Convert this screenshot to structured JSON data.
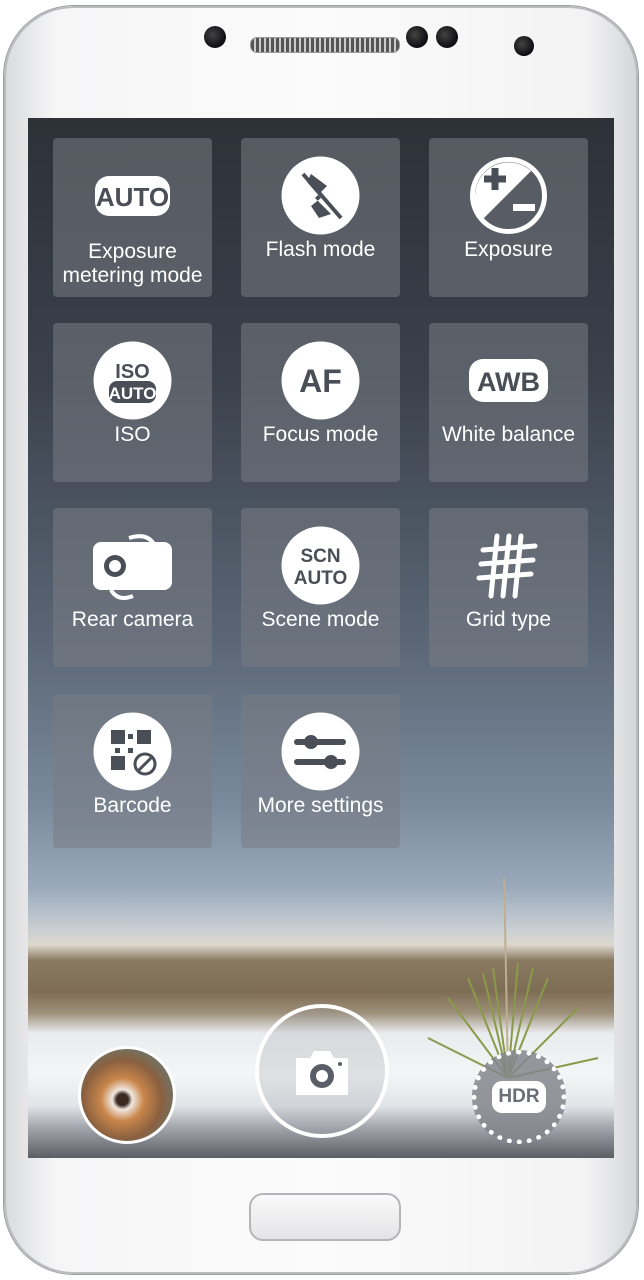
{
  "tiles": [
    {
      "label": "Exposure metering mode",
      "line1": "Exposure",
      "line2": "metering mode",
      "icon": "auto-metering-icon",
      "badge": "AUTO"
    },
    {
      "label": "Flash mode",
      "icon": "flash-off-icon"
    },
    {
      "label": "Exposure",
      "icon": "exposure-plus-minus-icon"
    },
    {
      "label": "ISO",
      "icon": "iso-auto-icon",
      "badge_top": "ISO",
      "badge_bottom": "AUTO"
    },
    {
      "label": "Focus mode",
      "icon": "af-icon",
      "badge": "AF"
    },
    {
      "label": "White balance",
      "icon": "awb-icon",
      "badge": "AWB"
    },
    {
      "label": "Rear camera",
      "icon": "switch-camera-icon"
    },
    {
      "label": "Scene mode",
      "icon": "scene-auto-icon",
      "badge_top": "SCN",
      "badge_bottom": "AUTO"
    },
    {
      "label": "Grid type",
      "icon": "grid-icon"
    },
    {
      "label": "Barcode",
      "icon": "barcode-icon"
    },
    {
      "label": "More settings",
      "icon": "sliders-icon"
    }
  ],
  "bottom": {
    "gallery_icon": "gallery-thumbnail-icon",
    "shutter_icon": "camera-icon",
    "hdr_label": "HDR"
  },
  "colors": {
    "tile_bg": "#787c84",
    "icon_fg": "#ffffff",
    "icon_glyph": "#4a4e56"
  }
}
